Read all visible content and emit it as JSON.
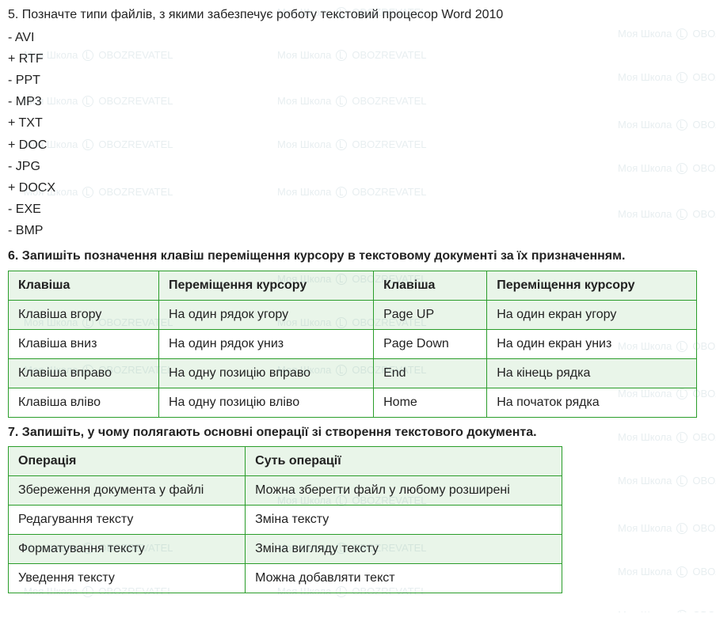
{
  "q5": {
    "prompt": "5. Позначте типи файлів, з якими забезпечує роботу текстовий процесор Word 2010",
    "options": [
      "- AVI",
      "+ RTF",
      "- PPT",
      "- MP3",
      "+ TXT",
      "+ DOC",
      "- JPG",
      "+ DOCX",
      "- EXE",
      "- BMP"
    ]
  },
  "q6": {
    "prompt": "6. Запишіть позначення клавіш переміщення курсору в текстовому документі за їх призначенням.",
    "headers": [
      "Клавіша",
      "Переміщення курсору",
      "Клавіша",
      "Переміщення курсору"
    ],
    "rows": [
      [
        "Клавіша вгору",
        "На один рядок угору",
        "Page UP",
        "На один екран угору"
      ],
      [
        "Клавіша вниз",
        "На один рядок униз",
        "Page Down",
        "На один екран униз"
      ],
      [
        "Клавіша вправо",
        "На одну позицію вправо",
        "End",
        "На кінець рядка"
      ],
      [
        "Клавіша вліво",
        "На одну позицію вліво",
        "Home",
        "На початок рядка"
      ]
    ]
  },
  "q7": {
    "prompt": "7. Запишіть, у чому полягають основні операції зі створення текстового документа.",
    "headers": [
      "Операція",
      "Суть операції"
    ],
    "rows": [
      [
        "Збереження документа у файлі",
        "Можна зберегти файл у любому розширені"
      ],
      [
        "Редагування тексту",
        "Зміна тексту"
      ],
      [
        "Форматування тексту",
        "Зміна вигляду тексту"
      ],
      [
        "Уведення тексту",
        "Можна добавляти текст"
      ]
    ]
  },
  "watermark": {
    "left": "Моя Школа",
    "right": "OBOZREVATEL"
  }
}
